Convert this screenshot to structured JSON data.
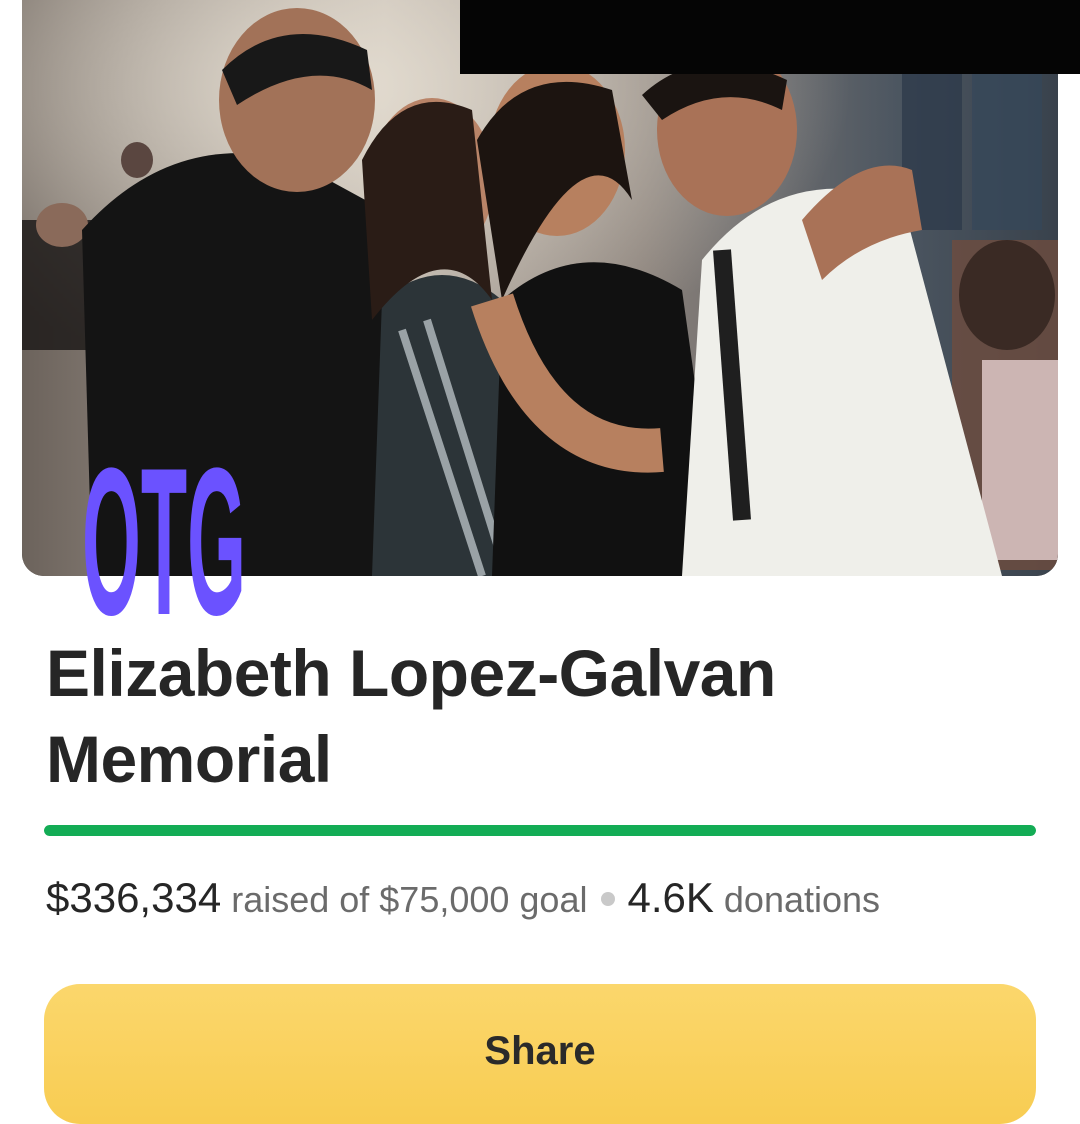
{
  "campaign": {
    "title": "Elizabeth Lopez-Galvan Memorial",
    "progress_percent": 100
  },
  "stats": {
    "raised": "$336,334",
    "raised_of_label": "raised of $75,000 goal",
    "donations_count": "4.6K",
    "donations_label": "donations"
  },
  "watermark": {
    "text": "OTG",
    "color": "#6b52ff"
  },
  "share": {
    "label": "Share",
    "color": "#f9d25f"
  },
  "colors": {
    "progress": "#13ac55",
    "title": "#262626",
    "muted": "#6b6b6b"
  }
}
